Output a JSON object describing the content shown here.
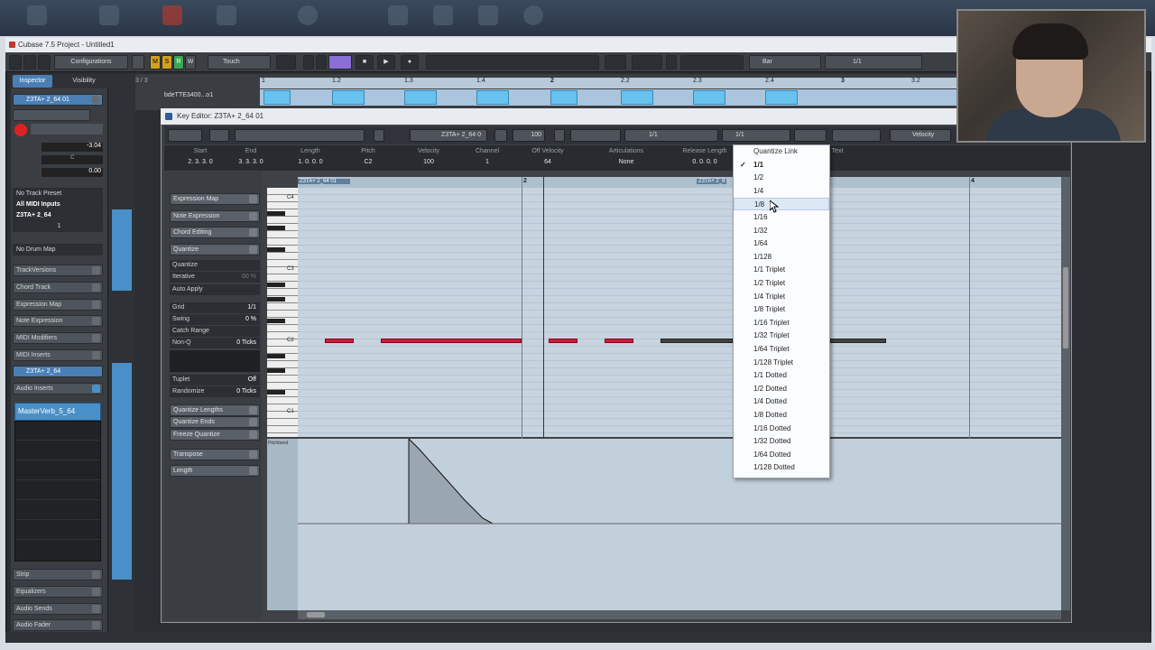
{
  "window": {
    "title": "Cubase 7.5 Project - Untitled1"
  },
  "main_toolbar": {
    "configurations": "Configurations",
    "mode": "Touch",
    "grid_type": "Bar",
    "quantize": "1/1",
    "buttons": {
      "m": "M",
      "s": "S",
      "r": "R",
      "w": "W"
    }
  },
  "inspector": {
    "tabs": [
      "Inspector",
      "Visibility"
    ],
    "track_name": "Z3TA+ 2_64 01",
    "volume": "-3.04",
    "pan": "C",
    "delay": "0.00",
    "no_track_preset": "No Track Preset",
    "all_midi_inputs": "All MIDI Inputs",
    "output": "Z3TA+ 2_64",
    "channel": "1",
    "no_drum_map": "No Drum Map",
    "sections": [
      "TrackVersions",
      "Chord Track",
      "Expression Map",
      "Note Expression",
      "MIDI Modifiers",
      "MIDI Inserts"
    ],
    "instrument": "Z3TA+ 2_64",
    "audio_inserts": "Audio Inserts",
    "insert_slot": "MasterVerb_5_64",
    "bottom_sections": [
      "Strip",
      "Equalizers",
      "Audio Sends",
      "Audio Fader"
    ]
  },
  "project": {
    "track_counter": "3 / 3",
    "track_label": "bdeTTE3400...o1",
    "ruler": [
      "1",
      "1.2",
      "1.3",
      "1.4",
      "2",
      "2.2",
      "2.3",
      "2.4",
      "3",
      "3.2"
    ]
  },
  "key_editor": {
    "title": "Key Editor: Z3TA+ 2_64 01",
    "toolbar": {
      "part": "Z3TA+ 2_64 0",
      "velocity_val": "100",
      "quantize": "1/1",
      "length_q": "1/1",
      "ctrl_lane": "Velocity"
    },
    "info": [
      {
        "h": "Start",
        "v": "2. 3. 3.   0"
      },
      {
        "h": "End",
        "v": "3. 3. 3.   0"
      },
      {
        "h": "Length",
        "v": "1. 0. 0.   0"
      },
      {
        "h": "Pitch",
        "v": "C2"
      },
      {
        "h": "Velocity",
        "v": "100"
      },
      {
        "h": "Channel",
        "v": "1"
      },
      {
        "h": "Off Velocity",
        "v": "64"
      },
      {
        "h": "Articulations",
        "v": "None"
      },
      {
        "h": "Release Length",
        "v": "0. 0. 0.   0"
      },
      {
        "h": "Text",
        "v": ""
      }
    ],
    "left": {
      "expression_map": "Expression Map",
      "note_expression": "Note Expression",
      "chord_editing": "Chord Editing",
      "quantize_header": "Quantize",
      "params": [
        {
          "l": "Quantize",
          "v": ""
        },
        {
          "l": "Iterative",
          "v": "60 %"
        },
        {
          "l": "Auto Apply",
          "v": ""
        },
        {
          "l": "Grid",
          "v": "1/1"
        },
        {
          "l": "Swing",
          "v": "0 %"
        },
        {
          "l": "Catch Range",
          "v": ""
        },
        {
          "l": "Non-Q",
          "v": "0 Ticks"
        },
        {
          "l": "Tuplet",
          "v": "Off"
        },
        {
          "l": "Randomize",
          "v": "0 Ticks"
        }
      ],
      "quantize_lengths": "Quantize Lengths",
      "quantize_ends": "Quantize Ends",
      "freeze_quantize": "Freeze Quantize",
      "transpose": "Transpose",
      "length": "Length"
    },
    "ruler": {
      "part_label": "Z3TA+ 2_64 01",
      "part_label2": "Z3TA+ 2_6",
      "bar2": "2",
      "bar4": "4"
    },
    "keys": {
      "c4": "C4",
      "c3": "C3",
      "c2": "C2",
      "c1": "C1"
    },
    "ctrl_lane_label": "Pitchbend"
  },
  "quantize_menu": {
    "header": "Quantize Link",
    "items": [
      "1/1",
      "1/2",
      "1/4",
      "1/8",
      "1/16",
      "1/32",
      "1/64",
      "1/128",
      "1/1 Triplet",
      "1/2 Triplet",
      "1/4 Triplet",
      "1/8 Triplet",
      "1/16 Triplet",
      "1/32 Triplet",
      "1/64 Triplet",
      "1/128 Triplet",
      "1/1 Dotted",
      "1/2 Dotted",
      "1/4 Dotted",
      "1/8 Dotted",
      "1/16 Dotted",
      "1/32 Dotted",
      "1/64 Dotted",
      "1/128 Dotted"
    ],
    "checked": "1/1",
    "hovered": "1/8",
    "checkmark": "✓"
  }
}
